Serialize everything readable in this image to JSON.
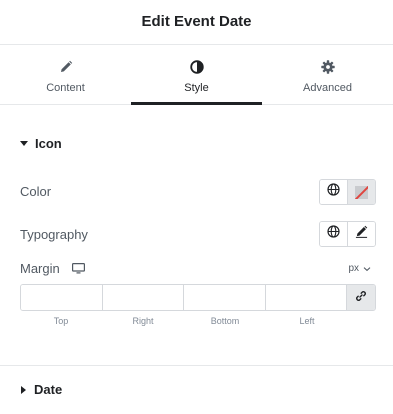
{
  "header": {
    "title": "Edit Event Date"
  },
  "tabs": [
    {
      "label": "Content",
      "icon": "pencil-icon",
      "active": false
    },
    {
      "label": "Style",
      "icon": "half-circle-icon",
      "active": true
    },
    {
      "label": "Advanced",
      "icon": "gear-icon",
      "active": false
    }
  ],
  "icon_section": {
    "title": "Icon",
    "expanded": true,
    "color_label": "Color",
    "typography_label": "Typography",
    "margin_label": "Margin",
    "margin_unit": "px",
    "margin_fields": [
      {
        "label": "Top",
        "value": ""
      },
      {
        "label": "Right",
        "value": ""
      },
      {
        "label": "Bottom",
        "value": ""
      },
      {
        "label": "Left",
        "value": ""
      }
    ]
  },
  "date_section": {
    "title": "Date",
    "expanded": false
  },
  "colors": {
    "accent": "#1f2124",
    "border": "#d5d8dc",
    "muted": "#515962"
  }
}
